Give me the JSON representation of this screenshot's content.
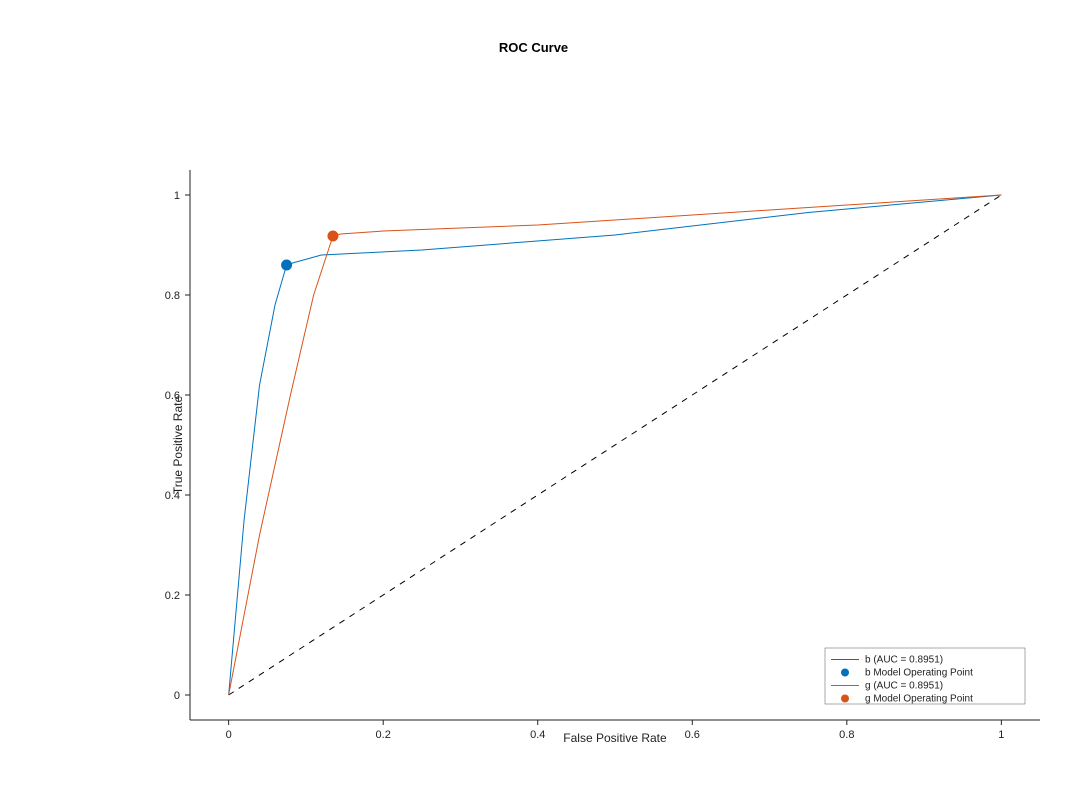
{
  "chart_data": {
    "type": "line",
    "title": "ROC Curve",
    "xlabel": "False Positive Rate",
    "ylabel": "True Positive Rate",
    "xlim": [
      -0.05,
      1.05
    ],
    "ylim": [
      -0.05,
      1.05
    ],
    "xticks": [
      0,
      0.2,
      0.4,
      0.6,
      0.8,
      1
    ],
    "yticks": [
      0,
      0.2,
      0.4,
      0.6,
      0.8,
      1
    ],
    "diagonal": [
      [
        0,
        0
      ],
      [
        1,
        1
      ]
    ],
    "series": [
      {
        "name": "b (AUC = 0.8951)",
        "color": "#0072BD",
        "x": [
          0.0,
          0.02,
          0.04,
          0.06,
          0.075,
          0.085,
          0.12,
          0.25,
          0.5,
          0.75,
          1.0
        ],
        "y": [
          0.0,
          0.35,
          0.62,
          0.78,
          0.86,
          0.865,
          0.88,
          0.89,
          0.92,
          0.965,
          1.0
        ],
        "operating_point": {
          "x": 0.075,
          "y": 0.86,
          "label": "b Model Operating Point"
        }
      },
      {
        "name": "g (AUC = 0.8951)",
        "color": "#D95319",
        "x": [
          0.0,
          0.04,
          0.08,
          0.11,
          0.135,
          0.145,
          0.2,
          0.4,
          0.6,
          0.8,
          1.0
        ],
        "y": [
          0.0,
          0.32,
          0.6,
          0.8,
          0.918,
          0.922,
          0.928,
          0.94,
          0.96,
          0.98,
          1.0
        ],
        "operating_point": {
          "x": 0.135,
          "y": 0.918,
          "label": "g Model Operating Point"
        }
      }
    ],
    "legend": {
      "entries": [
        {
          "type": "line",
          "color": "#0072BD",
          "label": "b (AUC = 0.8951)"
        },
        {
          "type": "marker",
          "color": "#0072BD",
          "label": "b Model Operating Point"
        },
        {
          "type": "line",
          "color": "#D95319",
          "label": "g (AUC = 0.8951)"
        },
        {
          "type": "marker",
          "color": "#D95319",
          "label": "g Model Operating Point"
        }
      ]
    }
  }
}
